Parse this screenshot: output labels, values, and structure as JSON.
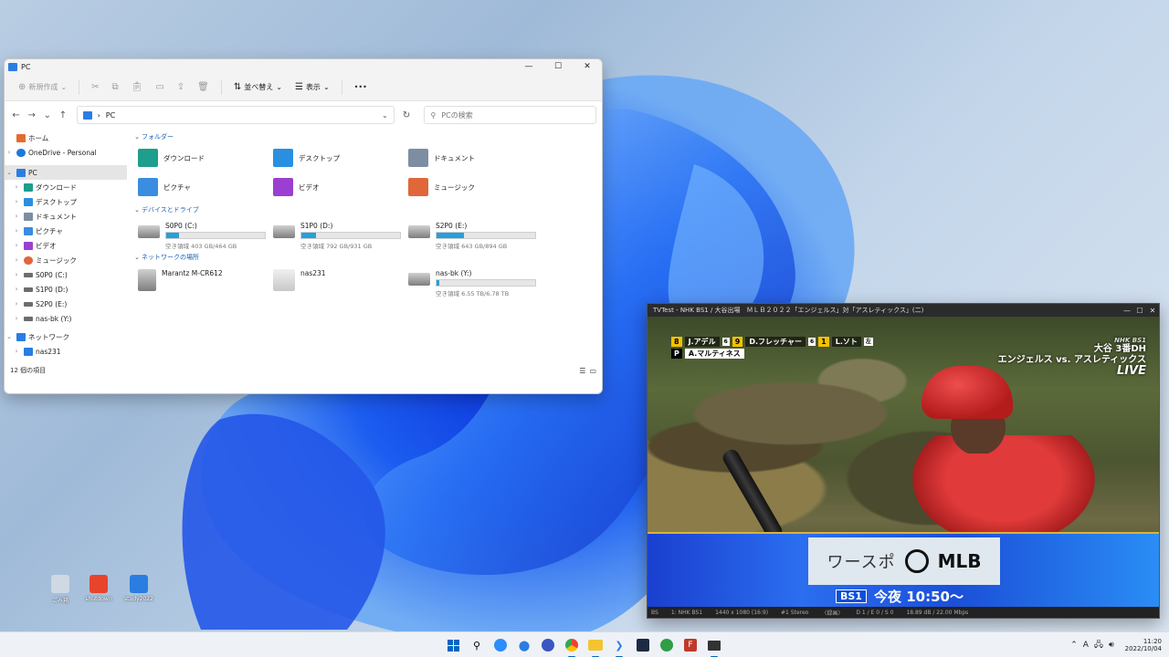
{
  "explorer": {
    "title": "PC",
    "toolbar": {
      "new_label": "新規作成",
      "sort_label": "並べ替え",
      "view_label": "表示",
      "more_label": "•••"
    },
    "address": "PC",
    "search_placeholder": "PCの検索",
    "nav": [
      {
        "label": "ホーム"
      },
      {
        "label": "OneDrive - Personal"
      },
      {
        "label": "PC"
      },
      {
        "label": "ダウンロード"
      },
      {
        "label": "デスクトップ"
      },
      {
        "label": "ドキュメント"
      },
      {
        "label": "ピクチャ"
      },
      {
        "label": "ビデオ"
      },
      {
        "label": "ミュージック"
      },
      {
        "label": "S0P0 (C:)"
      },
      {
        "label": "S1P0 (D:)"
      },
      {
        "label": "S2P0 (E:)"
      },
      {
        "label": "nas-bk (Y:)"
      },
      {
        "label": "ネットワーク"
      },
      {
        "label": "nas231"
      }
    ],
    "sections": {
      "folders": "フォルダー",
      "drives": "デバイスとドライブ",
      "network": "ネットワークの場所"
    },
    "folders": [
      {
        "label": "ダウンロード",
        "color": "#1e9e8c"
      },
      {
        "label": "デスクトップ",
        "color": "#2a8fe0"
      },
      {
        "label": "ドキュメント",
        "color": "#7d8ea3"
      },
      {
        "label": "ピクチャ",
        "color": "#3a8de0"
      },
      {
        "label": "ビデオ",
        "color": "#9b3fd0"
      },
      {
        "label": "ミュージック",
        "color": "#e0673a"
      }
    ],
    "drives": [
      {
        "label": "S0P0 (C:)",
        "free": "空き領域 403 GB/464 GB",
        "used_fraction": 0.13
      },
      {
        "label": "S1P0 (D:)",
        "free": "空き領域 792 GB/931 GB",
        "used_fraction": 0.15
      },
      {
        "label": "S2P0 (E:)",
        "free": "空き領域 643 GB/894 GB",
        "used_fraction": 0.28
      }
    ],
    "network_places": [
      {
        "label": "Marantz M-CR612"
      },
      {
        "label": "nas231"
      },
      {
        "label": "nas-bk (Y:)",
        "free": "空き領域 6.55 TB/6.78 TB",
        "used_fraction": 0.03
      }
    ],
    "status": "12 個の項目"
  },
  "tv": {
    "title": "TVTest - NHK BS1 / 大谷出場　ＭＬＢ２０２２「エンジェルス」対「アスレティックス」(二)",
    "score": {
      "b1_num": "8",
      "b1_name": "J.アデル",
      "b1_pos": "6",
      "b2_num": "9",
      "b2_name": "D.フレッチャー",
      "b2_pos": "6",
      "b3_num": "1",
      "b3_name": "L.ソト",
      "b3_pos": "左",
      "pitcher_tag": "P",
      "pitcher_name": "A.マルティネス"
    },
    "channel_logo": "NHK BS1",
    "inning": "大谷 3番DH",
    "match": "エンジェルス vs. アスレティックス",
    "live": "LIVE",
    "promo": {
      "jp": "ワースポ",
      "mlb": "MLB",
      "badge": "BS1",
      "time": "今夜 10:50〜"
    },
    "status": {
      "s1": "BS",
      "s2": "1: NHK BS1",
      "s3": "1440 x 1080 (16:9)",
      "s4": "#1 Stereo",
      "s5": "〈録画〉",
      "s6": "D 1 / E 0 / S 0",
      "s7": "18.89 dB / 22.00 Mbps"
    }
  },
  "desktop": [
    {
      "label": "ごみ箱",
      "color": "#cfd8e3"
    },
    {
      "label": "shutdown",
      "color": "#e8442c"
    },
    {
      "label": "study2022",
      "color": "#2a7de1"
    }
  ],
  "taskbar": {
    "apps": [
      "windows-start",
      "search",
      "zoom",
      "maps",
      "github",
      "chrome",
      "file-explorer",
      "vscode",
      "app-dark",
      "app-green",
      "filezilla",
      "tvtest"
    ],
    "ime": "A",
    "time": "11:20",
    "date": "2022/10/04"
  }
}
